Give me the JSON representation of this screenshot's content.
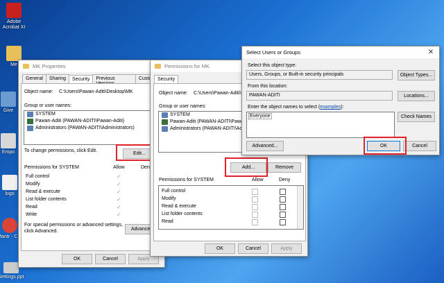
{
  "desktop": {
    "icons": [
      {
        "label": "Adobe Acrobat XI",
        "color": "#c8201e"
      },
      {
        "label": "Me",
        "color": "#e8c05a"
      },
      {
        "label": "Give",
        "color": "#6c9bd2"
      },
      {
        "label": "Empo",
        "color": "#d8d8d8"
      },
      {
        "label": "logo",
        "color": "#f0f0f0"
      },
      {
        "label": "Mantr - Chr",
        "color": "#db4437"
      },
      {
        "label": "Settings.ppt",
        "color": "#ccc"
      }
    ]
  },
  "mk_properties": {
    "title": "MK Properties",
    "tabs": [
      "General",
      "Sharing",
      "Security",
      "Previous Versions",
      "Customize"
    ],
    "object_name_label": "Object name:",
    "object_name_value": "C:\\Users\\Pawan-Aditi\\Desktop\\MK",
    "group_label": "Group or user names:",
    "users": [
      "SYSTEM",
      "Pawan-Aditi (PAWAN-ADITI\\Pawan-Aditi)",
      "Administrators (PAWAN-ADITI\\Administrators)"
    ],
    "change_hint": "To change permissions, click Edit.",
    "edit_button": "Edit...",
    "perm_for": "Permissions for SYSTEM",
    "allow": "Allow",
    "deny": "Deny",
    "permissions": [
      "Full control",
      "Modify",
      "Read & execute",
      "List folder contents",
      "Read",
      "Write"
    ],
    "special_hint_1": "For special permissions or advanced settings,",
    "special_hint_2": "click Advanced.",
    "advanced_button": "Advanced",
    "ok": "OK",
    "cancel": "Cancel",
    "apply": "Apply"
  },
  "permissions_mk": {
    "title": "Permissions for MK",
    "tab": "Security",
    "object_name_label": "Object name:",
    "object_name_value": "C:\\Users\\Pawan-Aditi\\D",
    "group_label": "Group or user names:",
    "users": [
      "SYSTEM",
      "Pawan-Aditi (PAWAN-ADITI\\Pawan",
      "Administrators (PAWAN-ADITI\\Ad"
    ],
    "add_button": "Add...",
    "remove_button": "Remove",
    "perm_for": "Permissions for SYSTEM",
    "allow": "Allow",
    "deny": "Deny",
    "permissions": [
      "Full control",
      "Modify",
      "Read & execute",
      "List folder contents",
      "Read"
    ],
    "ok": "OK",
    "cancel": "Cancel",
    "apply": "Apply"
  },
  "select_users": {
    "title": "Select Users or Groups",
    "object_type_label": "Select this object type:",
    "object_type_value": "Users, Groups, or Built-in security principals",
    "object_types_button": "Object Types...",
    "location_label": "From this location:",
    "location_value": "PAWAN-ADITI",
    "locations_button": "Locations...",
    "enter_label": "Enter the object names to select (",
    "examples_link": "examples",
    "enter_label_end": "):",
    "entered_value": "Everyone",
    "check_names_button": "Check Names",
    "advanced_button": "Advanced...",
    "ok": "OK",
    "cancel": "Cancel"
  }
}
